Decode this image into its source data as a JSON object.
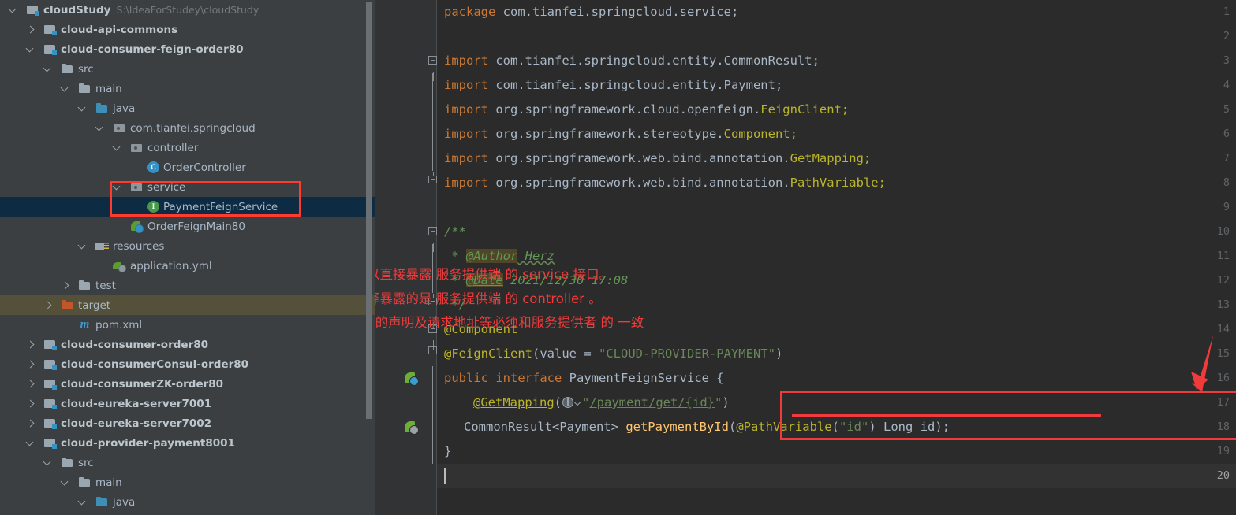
{
  "project_tree": {
    "scrollbar_present": true,
    "items": [
      {
        "indent": 0,
        "toggle": "expanded",
        "icon": "module-icon",
        "label": "cloudStudy",
        "bold": true,
        "path": "S:\\IdeaForStudey\\cloudStudy",
        "state": "normal"
      },
      {
        "indent": 1,
        "toggle": "collapsed",
        "icon": "module-icon",
        "label": "cloud-api-commons",
        "bold": true,
        "path": "",
        "state": "normal"
      },
      {
        "indent": 1,
        "toggle": "expanded",
        "icon": "module-icon",
        "label": "cloud-consumer-feign-order80",
        "bold": true,
        "path": "",
        "state": "normal"
      },
      {
        "indent": 2,
        "toggle": "expanded",
        "icon": "folder-icon",
        "label": "src",
        "bold": false,
        "path": "",
        "state": "normal"
      },
      {
        "indent": 3,
        "toggle": "expanded",
        "icon": "folder-icon",
        "label": "main",
        "bold": false,
        "path": "",
        "state": "normal"
      },
      {
        "indent": 4,
        "toggle": "expanded",
        "icon": "sources-folder-icon",
        "label": "java",
        "bold": false,
        "path": "",
        "state": "normal"
      },
      {
        "indent": 5,
        "toggle": "expanded",
        "icon": "package-icon",
        "label": "com.tianfei.springcloud",
        "bold": false,
        "path": "",
        "state": "normal"
      },
      {
        "indent": 6,
        "toggle": "expanded",
        "icon": "package-icon",
        "label": "controller",
        "bold": false,
        "path": "",
        "state": "normal"
      },
      {
        "indent": 7,
        "toggle": "none",
        "icon": "class-icon",
        "label": "OrderController",
        "bold": false,
        "path": "",
        "state": "normal"
      },
      {
        "indent": 6,
        "toggle": "expanded",
        "icon": "package-icon",
        "label": "service",
        "bold": false,
        "path": "",
        "state": "normal"
      },
      {
        "indent": 7,
        "toggle": "none",
        "icon": "interface-icon",
        "label": "PaymentFeignService",
        "bold": false,
        "path": "",
        "state": "selected"
      },
      {
        "indent": 6,
        "toggle": "none",
        "icon": "spring-boot-app-icon",
        "label": "OrderFeignMain80",
        "bold": false,
        "path": "",
        "state": "normal"
      },
      {
        "indent": 4,
        "toggle": "expanded",
        "icon": "resources-folder-icon",
        "label": "resources",
        "bold": false,
        "path": "",
        "state": "normal"
      },
      {
        "indent": 5,
        "toggle": "none",
        "icon": "yml-file-icon",
        "label": "application.yml",
        "bold": false,
        "path": "",
        "state": "normal"
      },
      {
        "indent": 3,
        "toggle": "collapsed",
        "icon": "folder-icon",
        "label": "test",
        "bold": false,
        "path": "",
        "state": "normal"
      },
      {
        "indent": 2,
        "toggle": "collapsed",
        "icon": "excluded-folder-icon",
        "label": "target",
        "bold": false,
        "path": "",
        "state": "excluded"
      },
      {
        "indent": 3,
        "toggle": "none",
        "icon": "maven-icon",
        "label": "pom.xml",
        "bold": false,
        "path": "",
        "state": "normal"
      },
      {
        "indent": 1,
        "toggle": "collapsed",
        "icon": "module-icon",
        "label": "cloud-consumer-order80",
        "bold": true,
        "path": "",
        "state": "normal"
      },
      {
        "indent": 1,
        "toggle": "collapsed",
        "icon": "module-icon",
        "label": "cloud-consumerConsul-order80",
        "bold": true,
        "path": "",
        "state": "normal"
      },
      {
        "indent": 1,
        "toggle": "collapsed",
        "icon": "module-icon",
        "label": "cloud-consumerZK-order80",
        "bold": true,
        "path": "",
        "state": "normal"
      },
      {
        "indent": 1,
        "toggle": "collapsed",
        "icon": "module-icon",
        "label": "cloud-eureka-server7001",
        "bold": true,
        "path": "",
        "state": "normal"
      },
      {
        "indent": 1,
        "toggle": "collapsed",
        "icon": "module-icon",
        "label": "cloud-eureka-server7002",
        "bold": true,
        "path": "",
        "state": "normal"
      },
      {
        "indent": 1,
        "toggle": "expanded",
        "icon": "module-icon",
        "label": "cloud-provider-payment8001",
        "bold": true,
        "path": "",
        "state": "normal"
      },
      {
        "indent": 2,
        "toggle": "expanded",
        "icon": "folder-icon",
        "label": "src",
        "bold": false,
        "path": "",
        "state": "normal"
      },
      {
        "indent": 3,
        "toggle": "expanded",
        "icon": "folder-icon",
        "label": "main",
        "bold": false,
        "path": "",
        "state": "normal"
      },
      {
        "indent": 4,
        "toggle": "expanded",
        "icon": "sources-folder-icon",
        "label": "java",
        "bold": false,
        "path": "",
        "state": "normal"
      }
    ],
    "highlight_box": {
      "color": "#ff3b30",
      "around": [
        "service",
        "PaymentFeignService"
      ]
    }
  },
  "editor": {
    "file_language": "java",
    "current_line": 20,
    "line_numbers": [
      1,
      2,
      3,
      4,
      5,
      6,
      7,
      8,
      9,
      10,
      11,
      12,
      13,
      14,
      15,
      16,
      17,
      18,
      19,
      20
    ],
    "gutter_icons": [
      {
        "line": 16,
        "icon": "spring-bean-icon"
      },
      {
        "line": 18,
        "icon": "spring-url-mapping-icon"
      }
    ],
    "lines": {
      "1": "package com.tianfei.springcloud.service;",
      "2": "",
      "3": "import com.tianfei.springcloud.entity.CommonResult;",
      "4": "import com.tianfei.springcloud.entity.Payment;",
      "5": "import org.springframework.cloud.openfeign.FeignClient;",
      "6": "import org.springframework.stereotype.Component;",
      "7": "import org.springframework.web.bind.annotation.GetMapping;",
      "8": "import org.springframework.web.bind.annotation.PathVariable;",
      "9": "",
      "10": "/**",
      "11": " * @Author Herz",
      "12": " * @Date 2021/12/30 17:08",
      "13": " */",
      "14": "@Component",
      "15": "@FeignClient(value = \"CLOUD-PROVIDER-PAYMENT\")",
      "16": "public interface PaymentFeignService {",
      "17": "    @GetMapping(\"/payment/get/{id}\")",
      "18": "    CommonResult<Payment> getPaymentById(@PathVariable(\"id\") Long id);",
      "19": "}",
      "20": ""
    },
    "tokens": {
      "kw_package": "package",
      "kw_import": "import",
      "kw_public": "public",
      "kw_interface": "interface",
      "pkg_service": " com.tianfei.springcloud.service;",
      "imp3": " com.tianfei.springcloud.entity.CommonResult;",
      "imp4": " com.tianfei.springcloud.entity.Payment;",
      "imp5_path": " org.springframework.cloud.openfeign.",
      "imp5_cls": "FeignClient;",
      "imp6_path": " org.springframework.stereotype.",
      "imp6_cls": "Component;",
      "imp7_path": " org.springframework.web.bind.annotation.",
      "imp7_cls": "GetMapping;",
      "imp8_path": " org.springframework.web.bind.annotation.",
      "imp8_cls": "PathVariable;",
      "doc_open": "/**",
      "doc_star": " * ",
      "doc_author_tag": "@Author",
      "doc_author_val": " Herz",
      "doc_date_tag": "@Date",
      "doc_date_val": " 2021/12/30 17:08",
      "doc_close": " */",
      "ann_component": "@Component",
      "ann_feignclient": "@FeignClient",
      "feign_open": "(",
      "feign_value": "value",
      "feign_eq": " = ",
      "feign_str": "\"CLOUD-PROVIDER-PAYMENT\"",
      "feign_close": ")",
      "iface_name": " PaymentFeignService {",
      "ann_getmapping": "@GetMapping",
      "gm_open": "(",
      "gm_q1": "\"",
      "gm_url": "/payment/get/{id}",
      "gm_q2": "\"",
      "gm_close": ")",
      "ret_type": "CommonResult<Payment> ",
      "method_name": "getPaymentById",
      "m_open": "(",
      "ann_pathvariable": "@PathVariable",
      "pv_open": "(",
      "pv_q1": "\"",
      "pv_id": "id",
      "pv_q2": "\"",
      "pv_close": ")",
      "param_type": " Long",
      "param_name": " id",
      "m_close": ");",
      "brace_close": "}"
    },
    "annotations": {
      "note_line_1": "这里也可以直接暴露 服务提供端 的 service 接口。",
      "note_line_2": "我这里选择暴露的是 服务提供端 的 controller 。",
      "note_line_3": "注意: 方法的声明及请求地址等必须和服务提供者 的 一致",
      "arrow": "red-down-arrow",
      "highlight_box_color": "#ef3b3b",
      "highlighted_code_lines": [
        17,
        18
      ]
    }
  },
  "colors": {
    "tree_bg": "#3c3f41",
    "editor_bg": "#2b2b2b",
    "gutter_bg": "#313335",
    "selection_bg": "#0d2b42",
    "excluded_bg": "#54503a",
    "current_line_bg": "#323232",
    "keyword": "#cc7832",
    "string": "#6a8759",
    "annotation": "#bbb529",
    "method": "#ffc66d",
    "identifier": "#a9b7c6",
    "comment": "#629755",
    "accent_red": "#ef3b3b"
  }
}
